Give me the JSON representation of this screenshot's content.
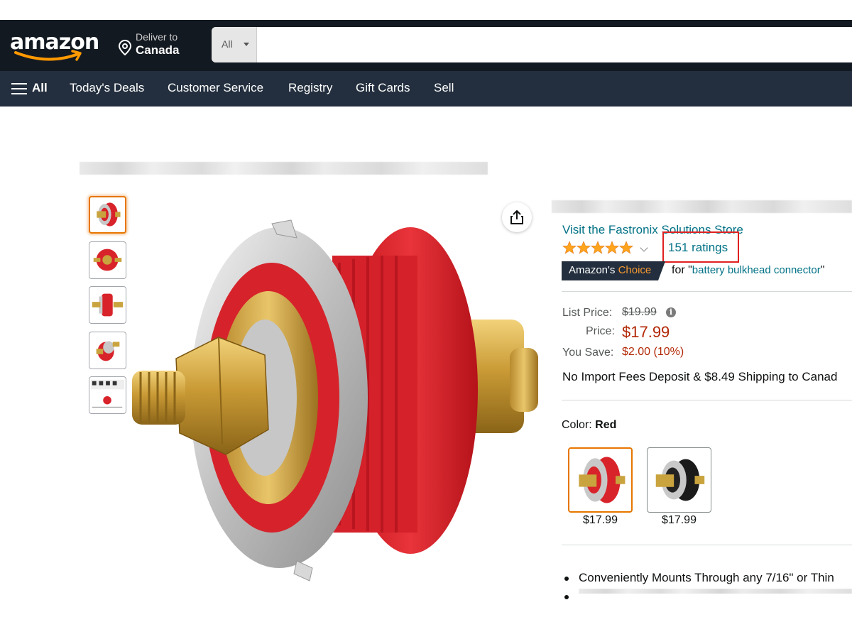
{
  "header": {
    "logo_text": "amazon",
    "deliver_line1": "Deliver to",
    "deliver_line2": "Canada",
    "search_category": "All",
    "search_value": ""
  },
  "nav": {
    "all_label": "All",
    "items": [
      "Today's Deals",
      "Customer Service",
      "Registry",
      "Gift Cards",
      "Sell"
    ]
  },
  "product": {
    "store_link": "Visit the Fastronix Solutions Store",
    "rating_stars": 5,
    "ratings_count": "151 ratings",
    "choice_prefix": "Amazon's",
    "choice_word": "Choice",
    "choice_for_prefix": "for \"",
    "choice_keyword": "battery bulkhead connector",
    "choice_for_suffix": "\"",
    "list_price_label": "List Price:",
    "list_price": "$19.99",
    "info_icon": "i",
    "price_label": "Price:",
    "price": "$17.99",
    "you_save_label": "You Save:",
    "you_save": "$2.00 (10%)",
    "shipping": "No Import Fees Deposit & $8.49 Shipping to Canad",
    "color_label": "Color:",
    "color_value": "Red",
    "swatches": [
      {
        "name": "Red",
        "price": "$17.99",
        "selected": true
      },
      {
        "name": "Black",
        "price": "$17.99",
        "selected": false
      }
    ],
    "bullet1": "Conveniently Mounts Through any 7/16\" or Thin"
  },
  "colors": {
    "header_bg": "#131921",
    "nav_bg": "#232f3e",
    "link": "#007185",
    "price_red": "#b12704",
    "star": "#ffa41c",
    "highlight_box": "#e02020",
    "selected_border": "#e77600"
  }
}
